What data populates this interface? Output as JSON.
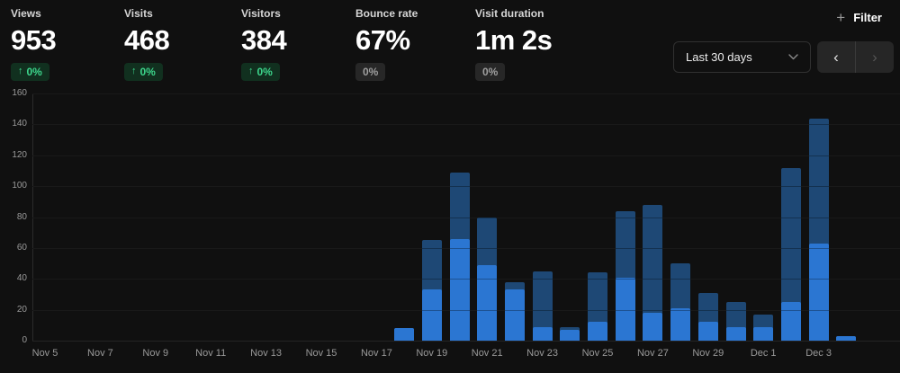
{
  "colors": {
    "background": "#101010",
    "bar_views": "#1e4875",
    "bar_visitors": "#2b76d2",
    "badge_positive_bg": "#11301f",
    "badge_positive_text": "#3dd68c",
    "badge_neutral_bg": "#272727",
    "badge_neutral_text": "#9f9f9f",
    "gridline": "#242424",
    "axis_text": "#9a9a9a"
  },
  "stats": [
    {
      "label": "Views",
      "value": "953",
      "badge": "0%",
      "trend": "up",
      "trend_icon": "↑"
    },
    {
      "label": "Visits",
      "value": "468",
      "badge": "0%",
      "trend": "up",
      "trend_icon": "↑"
    },
    {
      "label": "Visitors",
      "value": "384",
      "badge": "0%",
      "trend": "up",
      "trend_icon": "↑"
    },
    {
      "label": "Bounce rate",
      "value": "67%",
      "badge": "0%",
      "trend": "neutral"
    },
    {
      "label": "Visit duration",
      "value": "1m 2s",
      "badge": "0%",
      "trend": "neutral"
    }
  ],
  "controls": {
    "filter_label": "Filter",
    "filter_plus_icon": "+",
    "date_range": "Last 30 days",
    "prev_icon": "‹",
    "next_icon": "›",
    "icons": [
      "plus-icon",
      "chevron-down-icon",
      "chevron-left-icon",
      "chevron-right-icon"
    ],
    "next_disabled": true
  },
  "chart_data": {
    "type": "bar",
    "x": [
      "Nov 5",
      "Nov 6",
      "Nov 7",
      "Nov 8",
      "Nov 9",
      "Nov 10",
      "Nov 11",
      "Nov 12",
      "Nov 13",
      "Nov 14",
      "Nov 15",
      "Nov 16",
      "Nov 17",
      "Nov 18",
      "Nov 19",
      "Nov 20",
      "Nov 21",
      "Nov 22",
      "Nov 23",
      "Nov 24",
      "Nov 25",
      "Nov 26",
      "Nov 27",
      "Nov 28",
      "Nov 29",
      "Nov 30",
      "Dec 1",
      "Dec 2",
      "Dec 3",
      "Dec 4"
    ],
    "series": [
      {
        "name": "views",
        "color": "#1e4875",
        "values": [
          0,
          0,
          0,
          0,
          0,
          0,
          0,
          0,
          0,
          0,
          0,
          0,
          0,
          8,
          65,
          109,
          80,
          38,
          45,
          9,
          44,
          84,
          88,
          50,
          31,
          25,
          17,
          112,
          144,
          3
        ]
      },
      {
        "name": "visitors",
        "color": "#2b76d2",
        "values": [
          0,
          0,
          0,
          0,
          0,
          0,
          0,
          0,
          0,
          0,
          0,
          0,
          0,
          8,
          33,
          66,
          49,
          33,
          9,
          7,
          12,
          41,
          18,
          21,
          12,
          9,
          9,
          25,
          63,
          3
        ]
      }
    ],
    "overlay": true,
    "x_tick_labels": [
      "Nov 5",
      "Nov 7",
      "Nov 9",
      "Nov 11",
      "Nov 13",
      "Nov 15",
      "Nov 17",
      "Nov 19",
      "Nov 21",
      "Nov 23",
      "Nov 25",
      "Nov 27",
      "Nov 29",
      "Dec 1",
      "Dec 3"
    ],
    "y_ticks": [
      0,
      20,
      40,
      60,
      80,
      100,
      120,
      140,
      160
    ],
    "ylim": [
      0,
      160
    ],
    "grid": true,
    "legend": "none"
  }
}
